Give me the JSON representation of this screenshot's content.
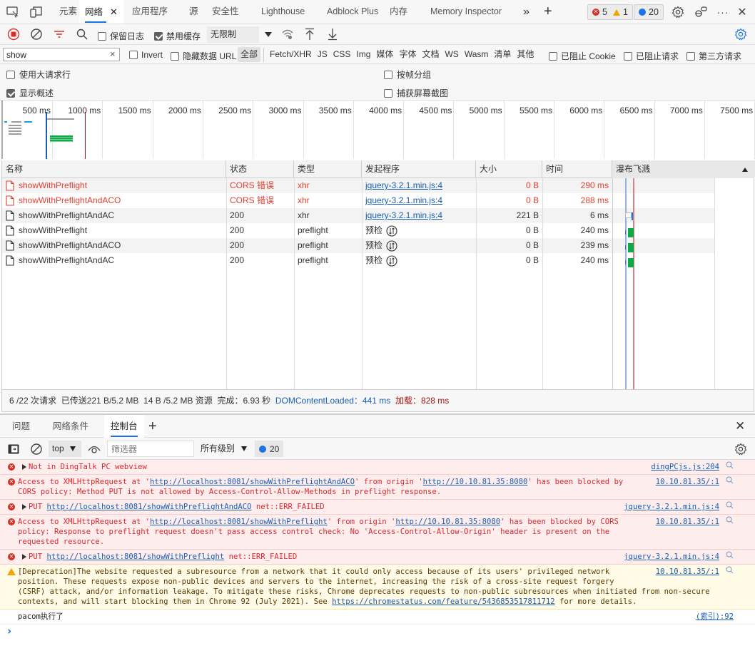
{
  "toptabs": {
    "items": [
      {
        "label": "元素"
      },
      {
        "label": "网络",
        "active": true
      },
      {
        "label": "应用程序"
      },
      {
        "label": "源"
      },
      {
        "label": "安全性"
      },
      {
        "label": "Lighthouse"
      },
      {
        "label": "Adblock Plus"
      },
      {
        "label": "内存"
      },
      {
        "label": "Memory Inspector"
      }
    ],
    "more_glyph": "»",
    "add_glyph": "+",
    "error_count": "5",
    "warning_count": "1",
    "info_count": "20",
    "close_glyph": "✕",
    "ellipsis": "···"
  },
  "network_toolbar": {
    "preserve_log": {
      "label": "保留日志",
      "checked": false
    },
    "disable_cache": {
      "label": "禁用缓存",
      "checked": true
    },
    "throttling": "无限制"
  },
  "filter_bar": {
    "search_value": "show",
    "invert": {
      "label": "Invert",
      "checked": false
    },
    "hide_data_urls": {
      "label": "隐藏数据 URL",
      "checked": false
    },
    "types": [
      "全部",
      "Fetch/XHR",
      "JS",
      "CSS",
      "Img",
      "媒体",
      "字体",
      "文档",
      "WS",
      "Wasm",
      "清单",
      "其他"
    ],
    "active_type": "全部",
    "blocked_cookies": {
      "label": "已阻止 Cookie",
      "checked": false
    },
    "blocked_requests": {
      "label": "已阻止请求",
      "checked": false
    },
    "third_party": {
      "label": "第三方请求",
      "checked": false
    }
  },
  "options": {
    "large_rows": {
      "label": "使用大请求行",
      "checked": false
    },
    "show_overview": {
      "label": "显示概述",
      "checked": true
    },
    "group_by_frame": {
      "label": "按帧分组",
      "checked": false
    },
    "capture_screenshots": {
      "label": "捕获屏幕截图",
      "checked": false
    }
  },
  "overview": {
    "ticks": [
      "500 ms",
      "1000 ms",
      "1500 ms",
      "2000 ms",
      "2500 ms",
      "3000 ms",
      "3500 ms",
      "4000 ms",
      "4500 ms",
      "5000 ms",
      "5500 ms",
      "6000 ms",
      "6500 ms",
      "7000 ms",
      "7500 ms"
    ],
    "dom_content_loaded_ms": 441,
    "load_ms": 828,
    "colors": {
      "dcl": "#1a5fb4",
      "load": "#a31515",
      "bar_green": "#0fa94a",
      "bar_gray": "#9e9e9e",
      "bar_blue": "#1ba1e2"
    }
  },
  "table": {
    "headers": {
      "name": "名称",
      "status": "状态",
      "type": "类型",
      "initiator": "发起程序",
      "size": "大小",
      "time": "时间",
      "waterfall": "瀑布飞溅"
    },
    "rows": [
      {
        "name": "showWithPreflight",
        "status": "CORS 错误",
        "type": "xhr",
        "initiator": "jquery-3.2.1.min.js:4",
        "initiator_link": true,
        "size": "0 B",
        "time": "290 ms",
        "error": true
      },
      {
        "name": "showWithPreflightAndACO",
        "status": "CORS 错误",
        "type": "xhr",
        "initiator": "jquery-3.2.1.min.js:4",
        "initiator_link": true,
        "size": "0 B",
        "time": "288 ms",
        "error": true
      },
      {
        "name": "showWithPreflightAndAC",
        "status": "200",
        "type": "xhr",
        "initiator": "jquery-3.2.1.min.js:4",
        "initiator_link": true,
        "size": "221 B",
        "time": "6 ms",
        "error": false
      },
      {
        "name": "showWithPreflight",
        "status": "200",
        "type": "preflight",
        "initiator": "预检",
        "initiator_link": false,
        "size": "0 B",
        "time": "240 ms",
        "error": false
      },
      {
        "name": "showWithPreflightAndACO",
        "status": "200",
        "type": "preflight",
        "initiator": "预检",
        "initiator_link": false,
        "size": "0 B",
        "time": "239 ms",
        "error": false
      },
      {
        "name": "showWithPreflightAndAC",
        "status": "200",
        "type": "preflight",
        "initiator": "预检",
        "initiator_link": false,
        "size": "0 B",
        "time": "240 ms",
        "error": false
      }
    ]
  },
  "status_bar": {
    "requests": "6 /22 次请求",
    "transferred": "已传送221 B/5.2 MB",
    "resources": "14 B /5.2 MB 资源",
    "finish": "完成：6.93 秒",
    "dcl": "DOMContentLoaded：441 ms",
    "load": "加载：828 ms"
  },
  "drawer": {
    "tabs": [
      {
        "label": "问题"
      },
      {
        "label": "网络条件"
      },
      {
        "label": "控制台",
        "active": true
      }
    ],
    "add_glyph": "+"
  },
  "console_toolbar": {
    "context": "top",
    "filter_placeholder": "筛选器",
    "levels": "所有级别",
    "info_count": "20"
  },
  "console": {
    "messages": [
      {
        "level": "error",
        "expandable": true,
        "lines": [
          "Not in DingTalk PC webview"
        ],
        "source": "dingPCjs.js:204"
      },
      {
        "level": "error",
        "expandable": false,
        "lines": [
          "Access to XMLHttpRequest at 'http://localhost:8081/showWithPreflightAndACO' from origin 'http://10.10.81.35:8080' has been blocked by",
          "CORS policy: Method PUT is not allowed by Access-Control-Allow-Methods in preflight response."
        ],
        "source": "10.10.81.35/:1"
      },
      {
        "level": "error",
        "expandable": true,
        "lines": [
          "PUT http://localhost:8081/showWithPreflightAndACO net::ERR_FAILED"
        ],
        "source": "jquery-3.2.1.min.js:4"
      },
      {
        "level": "error",
        "expandable": false,
        "lines": [
          "Access to XMLHttpRequest at 'http://localhost:8081/showWithPreflight' from origin 'http://10.10.81.35:8080' has been blocked by CORS",
          "policy: Response to preflight request doesn't pass access control check: No 'Access-Control-Allow-Origin' header is present on the",
          "requested resource."
        ],
        "source": "10.10.81.35/:1"
      },
      {
        "level": "error",
        "expandable": true,
        "lines": [
          "PUT http://localhost:8081/showWithPreflight net::ERR_FAILED"
        ],
        "source": "jquery-3.2.1.min.js:4"
      },
      {
        "level": "warning",
        "expandable": false,
        "lines": [
          "[Deprecation]The website requested a subresource from a network that it could only access because of its users' privileged network",
          "position. These requests expose non-public devices and servers to the internet, increasing the risk of a cross-site request forgery",
          "(CSRF) attack, and/or information leakage. To mitigate these risks, Chrome deprecates requests to non-public subresources when initiated from non-secure",
          "contexts, and will start blocking them in Chrome 92 (July 2021). See https://chromestatus.com/feature/5436853517811712 for more details."
        ],
        "source": "10.10.81.35/:1"
      },
      {
        "level": "log",
        "expandable": false,
        "lines": [
          "pacom执行了"
        ],
        "source": "(索引):92"
      }
    ],
    "prompt_glyph": "›"
  }
}
